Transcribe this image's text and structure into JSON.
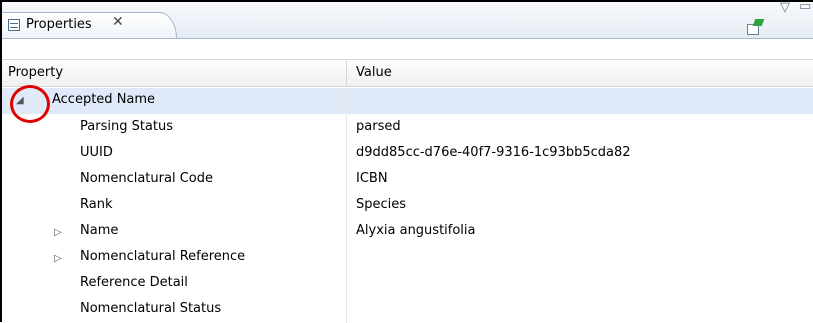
{
  "view": {
    "tab_label": "Properties",
    "tab_close": "✕",
    "toolbar": {
      "menu_icon": "▽",
      "minimize_icon": "▭",
      "pin_icon": "pin-editor-icon"
    }
  },
  "table": {
    "columns": [
      "Property",
      "Value"
    ],
    "rows": [
      {
        "name": "Accepted Name",
        "value": "",
        "expander": "expanded",
        "level": 0
      },
      {
        "name": "Parsing Status",
        "value": "parsed",
        "expander": "none",
        "level": 1
      },
      {
        "name": "UUID",
        "value": "d9dd85cc-d76e-40f7-9316-1c93bb5cda82",
        "expander": "none",
        "level": 1
      },
      {
        "name": "Nomenclatural Code",
        "value": "ICBN",
        "expander": "none",
        "level": 1
      },
      {
        "name": "Rank",
        "value": "Species",
        "expander": "none",
        "level": 1
      },
      {
        "name": "Name",
        "value": "Alyxia angustifolia",
        "expander": "collapsed",
        "level": 1
      },
      {
        "name": "Nomenclatural Reference",
        "value": "",
        "expander": "collapsed",
        "level": 1
      },
      {
        "name": "Reference Detail",
        "value": "",
        "expander": "none",
        "level": 1
      },
      {
        "name": "Nomenclatural Status",
        "value": "",
        "expander": "none",
        "level": 1
      }
    ]
  },
  "colors": {
    "selection": "#dfe9f7",
    "annotation": "#e00000"
  }
}
